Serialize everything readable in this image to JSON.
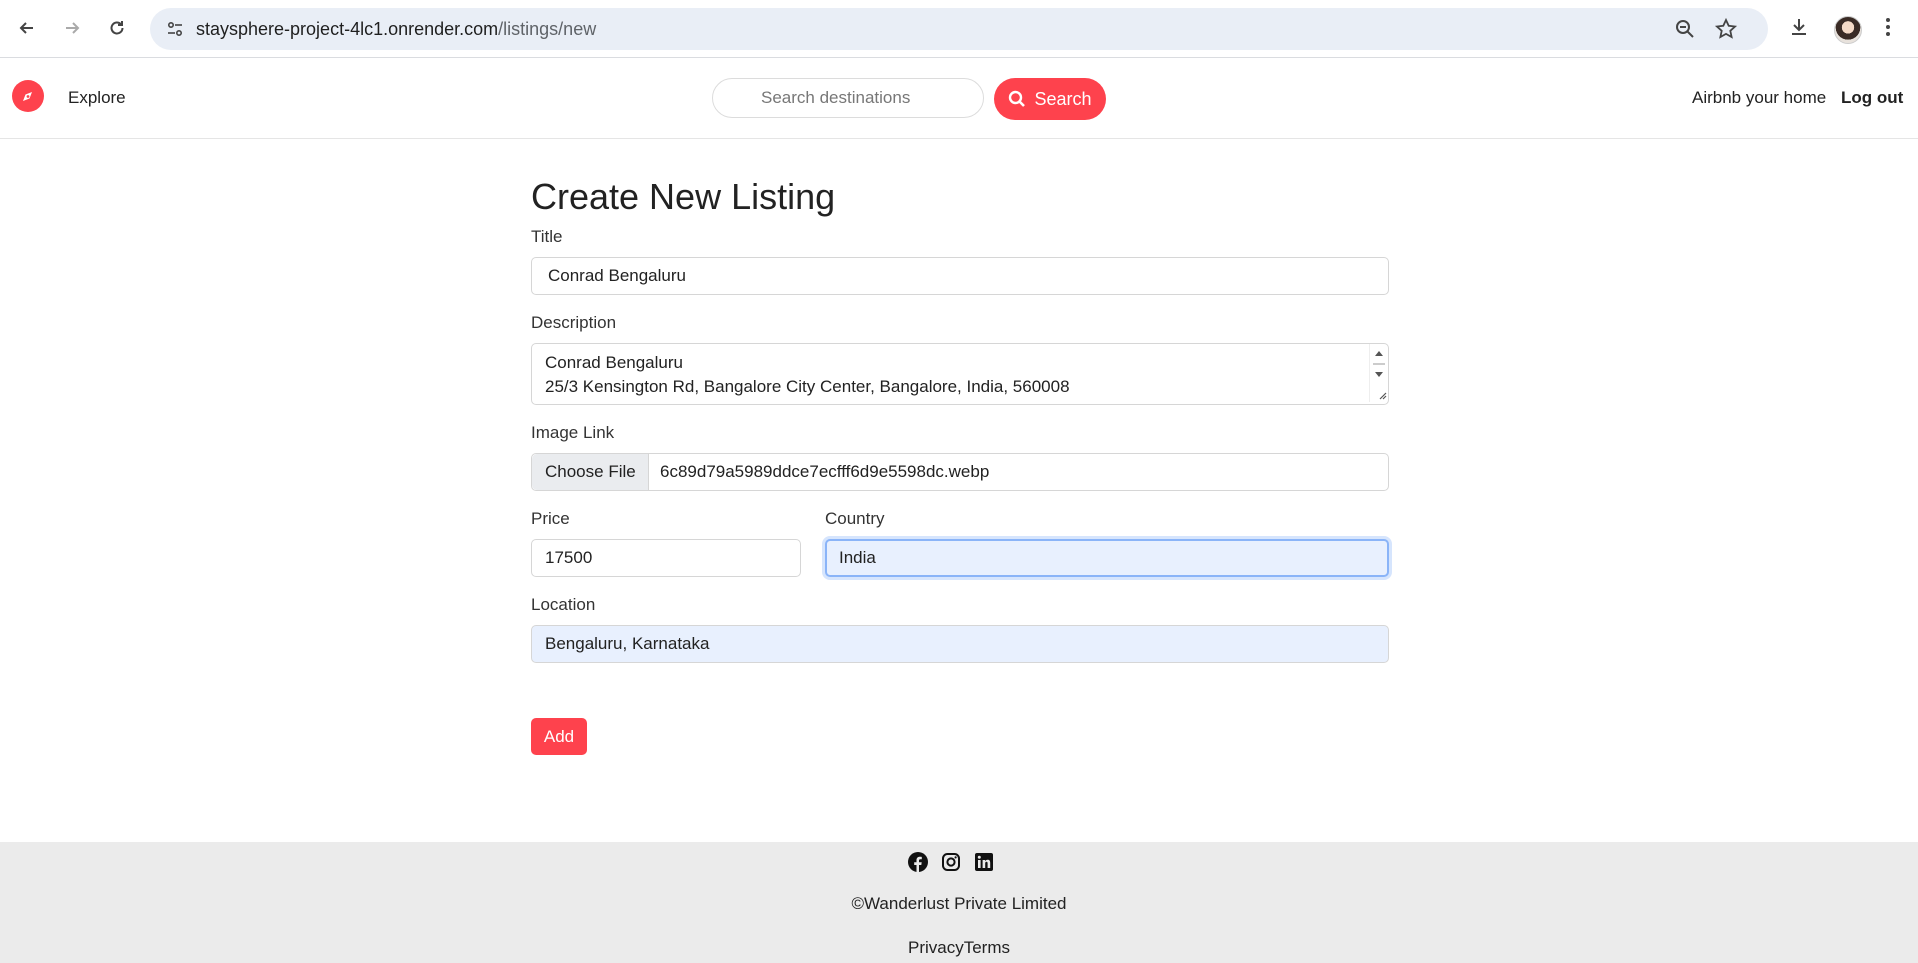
{
  "browser": {
    "url_host": "staysphere-project-4lc1.onrender.com",
    "url_path": "/listings/new"
  },
  "navbar": {
    "explore_label": "Explore",
    "search_placeholder": "Search destinations",
    "search_button": "Search",
    "host_link": "Airbnb your home",
    "logout_link": "Log out",
    "brand_color": "#fe424d"
  },
  "form": {
    "heading": "Create New Listing",
    "title_label": "Title",
    "title_value": "Conrad Bengaluru",
    "description_label": "Description",
    "description_line1": "Conrad Bengaluru",
    "description_line2": "25/3 Kensington Rd, Bangalore City Center, Bangalore, India, 560008",
    "image_label": "Image Link",
    "choose_file": "Choose File",
    "file_name": "6c89d79a5989ddce7ecfff6d9e5598dc.webp",
    "price_label": "Price",
    "price_value": "17500",
    "country_label": "Country",
    "country_value": "India",
    "location_label": "Location",
    "location_value": "Bengaluru, Karnataka",
    "submit": "Add"
  },
  "footer": {
    "icons": [
      "facebook-icon",
      "instagram-icon",
      "linkedin-icon"
    ],
    "copyright": "©Wanderlust Private Limited",
    "privacy": "Privacy",
    "terms": "Terms"
  }
}
